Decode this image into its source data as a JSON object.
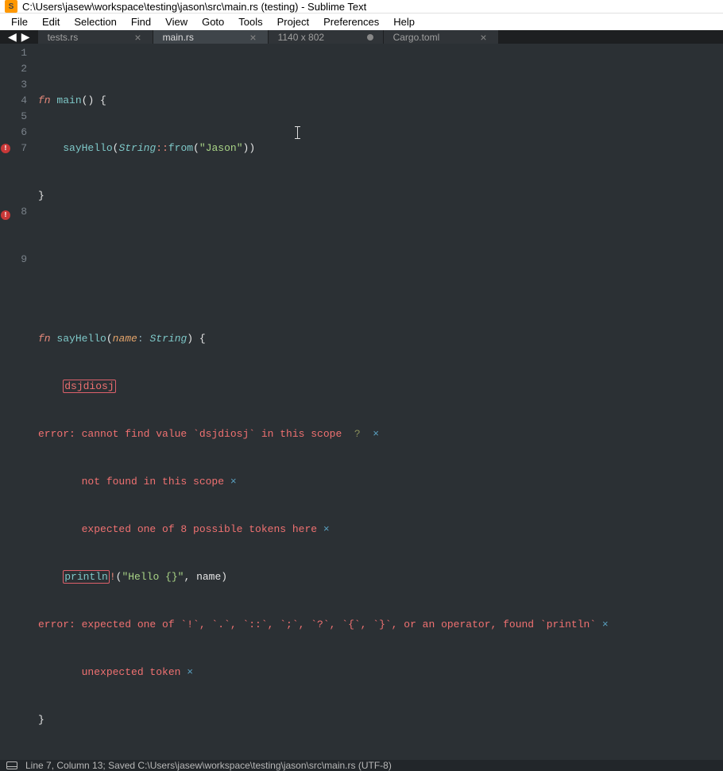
{
  "title": "C:\\Users\\jasew\\workspace\\testing\\jason\\src\\main.rs (testing) - Sublime Text",
  "menu": [
    "File",
    "Edit",
    "Selection",
    "Find",
    "View",
    "Goto",
    "Tools",
    "Project",
    "Preferences",
    "Help"
  ],
  "tabs": [
    {
      "label": "tests.rs",
      "active": false,
      "dirty": false
    },
    {
      "label": "main.rs",
      "active": true,
      "dirty": false
    },
    {
      "label": "1140 x 802",
      "active": false,
      "dirty": true
    },
    {
      "label": "Cargo.toml",
      "active": false,
      "dirty": false
    }
  ],
  "lines": [
    "1",
    "2",
    "3",
    "4",
    "5",
    "6",
    "7",
    "",
    "",
    "",
    "8",
    "",
    "",
    "9"
  ],
  "error_rows": [
    6,
    10
  ],
  "code": {
    "l1": {
      "kw": "fn",
      "name": "main",
      "p": "() {"
    },
    "l2": {
      "indent": "    ",
      "fn": "sayHello",
      "p1": "(",
      "type": "String",
      "op": "::",
      "method": "from",
      "p2": "(",
      "str": "\"Jason\"",
      "p3": "))"
    },
    "l3": "}",
    "l6": {
      "kw": "fn",
      "name": "sayHello",
      "p1": "(",
      "param": "name",
      "colon": ": ",
      "type": "String",
      "p2": ") {"
    },
    "l7": {
      "indent": "    ",
      "boxed": "dsjdiosj"
    },
    "e1": "error: cannot find value `dsjdiosj` in this scope  ",
    "e1q": "?",
    "e1x": "  ×",
    "e2": "       not found in this scope ",
    "e2x": "×",
    "e3": "       expected one of 8 possible tokens here ",
    "e3x": "×",
    "l8": {
      "indent": "    ",
      "boxed": "println",
      "bang": "!",
      "p1": "(",
      "str": "\"Hello {}\"",
      "comma": ", name)"
    },
    "e4": "error: expected one of `!`, `.`, `::`, `;`, `?`, `{`, `}`, or an operator, found `println` ",
    "e4x": "×",
    "e5": "       unexpected token ",
    "e5x": "×",
    "l9": "}"
  },
  "status": "Line 7, Column 13; Saved C:\\Users\\jasew\\workspace\\testing\\jason\\src\\main.rs (UTF-8)"
}
